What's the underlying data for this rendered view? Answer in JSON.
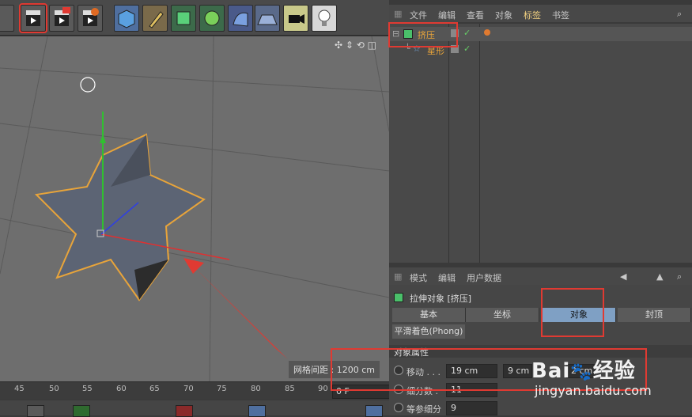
{
  "toolbar": {
    "icons": [
      "render-view-icon",
      "render-picture-icon",
      "render-settings-icon",
      "cube-icon",
      "pen-icon",
      "subdivision-icon",
      "array-icon",
      "nurbs-icon",
      "deformer-icon",
      "scene-floor-icon",
      "camera-icon",
      "light-icon"
    ]
  },
  "viewport": {
    "grid_spacing": "网格间距 : 1200 cm"
  },
  "timeline": {
    "ticks": [
      "45",
      "50",
      "55",
      "60",
      "65",
      "70",
      "75",
      "80",
      "85",
      "90"
    ],
    "frame": "0 F"
  },
  "object_manager": {
    "menu": [
      "文件",
      "编辑",
      "查看",
      "对象",
      "标签",
      "书签"
    ],
    "objects": [
      {
        "name": "挤压",
        "color": "#e8a43a"
      },
      {
        "name": "星形",
        "color": "#e8a43a"
      }
    ]
  },
  "attribute_manager": {
    "menu": [
      "模式",
      "编辑",
      "用户数据"
    ],
    "object_title": "拉伸对象 [挤压]",
    "tabs": [
      "基本",
      "坐标",
      "对象",
      "封顶"
    ],
    "active_tab": "对象",
    "subtab": "平滑着色(Phong)",
    "section_title": "对象属性",
    "props": [
      {
        "label": "移动 . . .",
        "values": [
          "19 cm",
          "9 cm",
          "2 cm"
        ]
      },
      {
        "label": "细分数 .",
        "values": [
          "11"
        ]
      },
      {
        "label": "等参细分",
        "values": [
          "9"
        ]
      }
    ]
  },
  "watermark": {
    "brand": "Bai",
    "jingyan": "经验",
    "url": "jingyan.baidu.com"
  },
  "colors": {
    "highlight": "#e03a32",
    "active_tab": "#7fa0c4",
    "object_name": "#e8a43a"
  }
}
